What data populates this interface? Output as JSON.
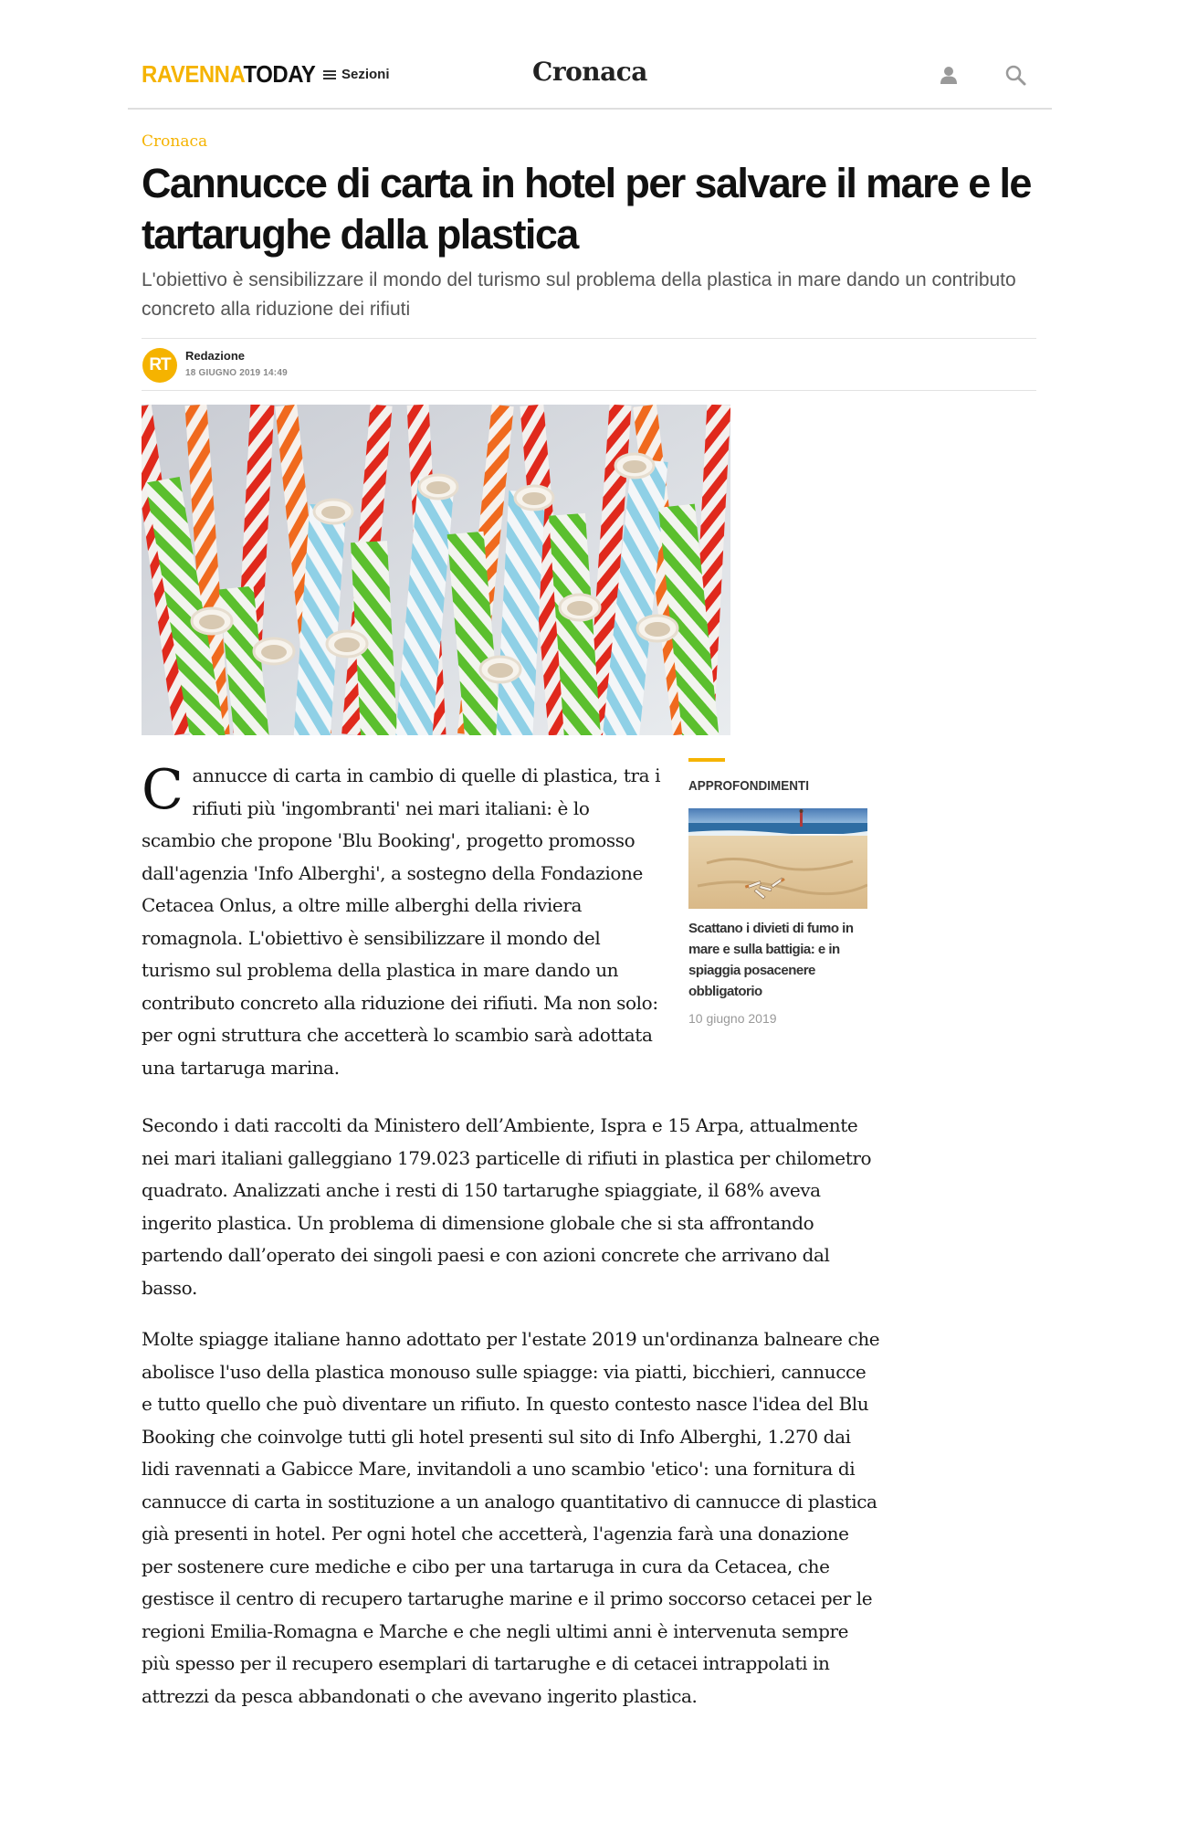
{
  "header": {
    "logo_part1": "RAVENNA",
    "logo_part2": "TODAY",
    "menu_label": "Sezioni",
    "section_title": "Cronaca",
    "accent_color": "#f5b300"
  },
  "article": {
    "kicker": "Cronaca",
    "headline": "Cannucce di carta in hotel per salvare il mare e le tartarughe dalla plastica",
    "subtitle": "L'obiettivo è sensibilizzare il mondo del turismo sul problema della plastica in mare dando un contributo concreto alla riduzione dei rifiuti",
    "author_initials": "RT",
    "author": "Redazione",
    "date": "18 GIUGNO 2019 14:49",
    "dropcap": "C",
    "paragraph1": "annucce di carta in cambio di quelle di plastica, tra i rifiuti più 'ingombranti' nei mari italiani: è lo scambio che propone 'Blu Booking', progetto promosso dall'agenzia 'Info Alberghi', a sostegno della Fondazione Cetacea Onlus, a oltre mille alberghi della riviera romagnola. L'obiettivo è sensibilizzare il mondo del turismo sul problema della plastica in mare dando un contributo concreto alla riduzione dei rifiuti. Ma non solo: per ogni struttura che accetterà lo scambio sarà adottata una tartaruga marina.",
    "paragraph2": "Secondo i dati raccolti da Ministero dell’Ambiente, Ispra e 15 Arpa, attualmente nei mari italiani galleggiano 179.023 particelle di rifiuti in plastica per chilometro quadrato. Analizzati anche i resti di 150 tartarughe spiaggiate, il 68% aveva ingerito plastica. Un problema di dimensione globale che si sta affrontando partendo dall’operato dei singoli paesi e con azioni concrete che arrivano dal basso.",
    "paragraph3": "Molte spiagge italiane hanno adottato per l'estate 2019 un'ordinanza balneare che abolisce l'uso della plastica monouso sulle spiagge: via piatti, bicchieri, cannucce e tutto quello che può diventare un rifiuto. In questo contesto nasce l'idea del Blu Booking che coinvolge tutti gli hotel presenti sul sito di Info Alberghi, 1.270 dai lidi ravennati a Gabicce Mare, invitandoli a uno scambio 'etico': una fornitura di cannucce di carta in sostituzione a un analogo quantitativo di cannucce di plastica già presenti in hotel. Per ogni hotel che accetterà, l'agenzia farà una donazione per sostenere cure mediche e cibo per una tartaruga in cura da Cetacea, che gestisce il centro di recupero tartarughe marine e il primo soccorso cetacei per le regioni Emilia-Romagna e Marche e che negli ultimi anni è intervenuta sempre più spesso per il recupero esemplari di tartarughe e di cetacei intrappolati in attrezzi da pesca abbandonati o che avevano ingerito plastica."
  },
  "sidebar": {
    "label": "APPROFONDIMENTI",
    "related_title": "Scattano i divieti di fumo in mare e sulla battigia: e in spiaggia posacenere obbligatorio",
    "related_date": "10 giugno 2019"
  }
}
